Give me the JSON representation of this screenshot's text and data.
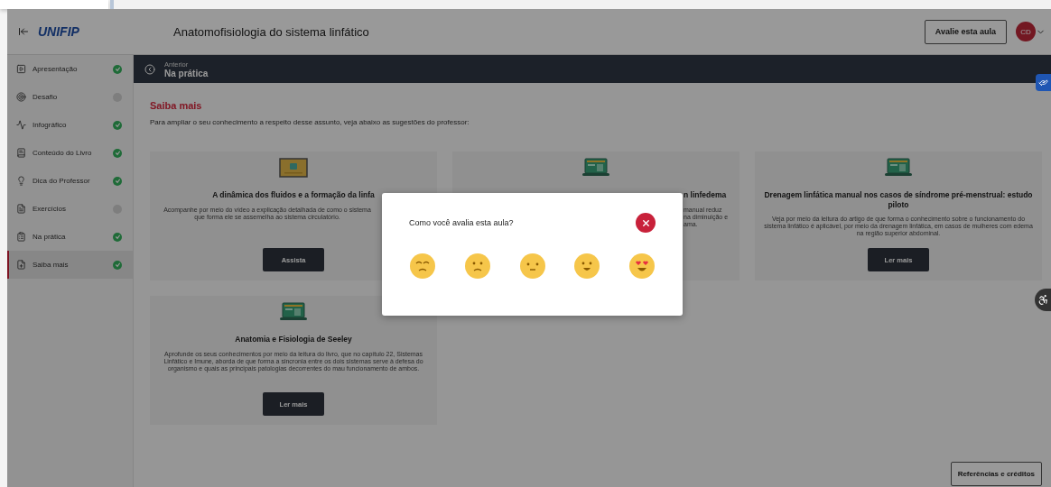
{
  "header": {
    "logo": "UNIFIP",
    "title": "Anatomofisiologia do sistema linfático",
    "rate_button": "Avalie esta aula",
    "avatar": "CD"
  },
  "sidebar": {
    "items": [
      {
        "kind": "play",
        "label": "Apresentação",
        "done": true,
        "selected": false
      },
      {
        "kind": "target",
        "label": "Desafio",
        "done": false,
        "selected": false
      },
      {
        "kind": "chart",
        "label": "Infográfico",
        "done": true,
        "selected": false
      },
      {
        "kind": "book",
        "label": "Conteúdo do Livro",
        "done": true,
        "selected": false
      },
      {
        "kind": "bulb",
        "label": "Dica do Professor",
        "done": true,
        "selected": false
      },
      {
        "kind": "file",
        "label": "Exercícios",
        "done": false,
        "selected": false
      },
      {
        "kind": "clipboard",
        "label": "Na prática",
        "done": true,
        "selected": false
      },
      {
        "kind": "file-plus",
        "label": "Saiba mais",
        "done": true,
        "selected": true
      }
    ]
  },
  "nav_bar": {
    "caption": "Anterior",
    "label": "Na prática"
  },
  "section": {
    "title": "Saiba mais",
    "intro": "Para ampliar o seu conhecimento a respeito desse assunto, veja abaixo as sugestões do professor:"
  },
  "cards": [
    {
      "kind": "video",
      "title": "A dinâmica dos fluidos e a formação da linfa",
      "description": "Acompanhe por meio do vídeo a explicação detalhada de como o sistema\nque forma ele se assemelha ao sistema circulatório.",
      "button": "Assista"
    },
    {
      "kind": "covered",
      "title": "n linfedema",
      "description": "manual reduz\nna diminuição e\nama."
    },
    {
      "kind": "article",
      "title": "Drenagem linfática manual nos casos de síndrome pré-menstrual: estudo piloto",
      "description": "Veja por meio da leitura do artigo de que forma o conhecimento sobre o funcionamento do sistema linfático é aplicável, por meio da drenagem linfática, em casos de mulheres com edema na região superior abdominal.",
      "button": "Ler mais"
    },
    {
      "kind": "article",
      "title": "Anatomia e Fisiologia de Seeley",
      "description": "Aprofunde os seus conhecimentos por meio da leitura do livro, que no capítulo 22, Sistemas Linfático e Imune, aborda de que forma a sincronia entre os dois sistemas serve à defesa do organismo e quais as principais patologias decorrentes do mau funcionamento de ambos.",
      "button": "Ler mais"
    }
  ],
  "footer_button": "Referências e créditos",
  "modal": {
    "question": "Como você avalia esta aula?",
    "ratings": [
      {
        "kind": "tired"
      },
      {
        "kind": "sad"
      },
      {
        "kind": "neutral"
      },
      {
        "kind": "happy"
      },
      {
        "kind": "love"
      }
    ]
  }
}
